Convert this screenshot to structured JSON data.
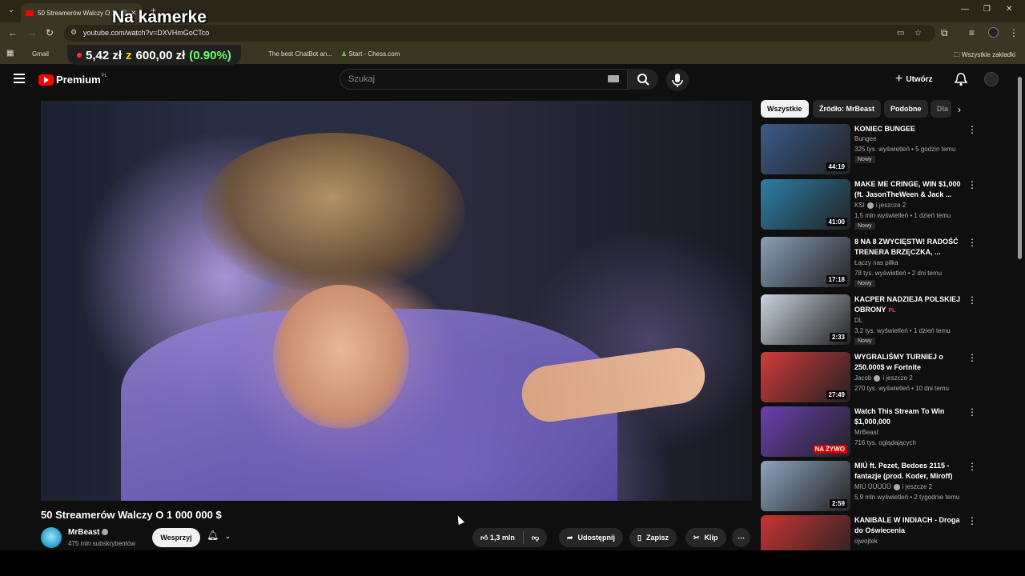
{
  "browser": {
    "tab_title": "50 Streamerów Walczy O 1...",
    "url": "youtube.com/watch?v=DXVHmGoCTco",
    "bookmarks": [
      "Gmail",
      "The best ChatBot an...",
      "Start - Chess.com"
    ],
    "all_bookmarks": "Wszystkie zakładki"
  },
  "overlay": {
    "title": "Na kamerke",
    "price_current": "5,42 zł",
    "price_of": "z",
    "price_goal": "600,00 zł",
    "price_pct": "(0.90%)"
  },
  "header": {
    "brand": "Premium",
    "brand_suffix": "PL",
    "search_placeholder": "Szukaj",
    "create_label": "Utwórz"
  },
  "video": {
    "title": "50 Streamerów Walczy O 1 000 000 $",
    "channel": "MrBeast",
    "subscribers": "475 mln subskrybentów",
    "support_label": "Wesprzyj",
    "likes": "1,3 mln",
    "share_label": "Udostępnij",
    "save_label": "Zapisz",
    "clip_label": "Klip"
  },
  "chips": [
    "Wszystkie",
    "Źródło: MrBeast",
    "Podobne",
    "Dla"
  ],
  "recommendations": [
    {
      "title": "KONIEC BUNGEE",
      "channel": "Bungee",
      "meta": "325 tys. wyświetleń • 5 godzin temu",
      "badge": "Nowy",
      "duration": "44:19",
      "thumb_color": "#3b5a8a"
    },
    {
      "title": "MAKE ME CRINGE, WIN $1,000 (ft. JasonTheWeen & Jack ...",
      "channel": "KSI",
      "channel_suffix": "i jeszcze 2",
      "meta": "1,5 mln wyświetleń • 1 dzień temu",
      "badge": "Nowy",
      "duration": "41:00",
      "thumb_color": "#2b7fa8"
    },
    {
      "title": "8 NA 8 ZWYCIĘSTW! RADOŚĆ TRENERA BRZĘCZKA, ...",
      "channel": "Łączy nas piłka",
      "meta": "78 tys. wyświetleń • 2 dni temu",
      "badge": "Nowy",
      "duration": "17:18",
      "thumb_color": "#8aa0b8"
    },
    {
      "title": "KACPER NADZIEJA POLSKIEJ OBRONY",
      "title_flag": "PL",
      "channel": "DL",
      "meta": "3,2 tys. wyświetleń • 1 dzień temu",
      "badge": "Nowy",
      "duration": "2:33",
      "thumb_color": "#c9d3de"
    },
    {
      "title": "WYGRALIŚMY TURNIEJ o 250.000$ w Fortnite",
      "channel": "Jacob",
      "channel_suffix": "i jeszcze 2",
      "meta": "270 tys. wyświetleń • 10 dni temu",
      "duration": "27:49",
      "thumb_color": "#d23a3a"
    },
    {
      "title": "Watch This Stream To Win $1,000,000",
      "channel": "MrBeast",
      "meta": "716 tys. oglądających",
      "duration": "NA ŻYWO",
      "thumb_color": "#6a3fb0"
    },
    {
      "title": "MIÚ ft. Pezet, Bedoes 2115 - fantazje (prod. Koder, Miroff)",
      "channel": "MIÚ ÜÜÜÜÜ",
      "channel_suffix": "i jeszcze 2",
      "meta": "5,9 mln wyświetleń • 2 tygodnie temu",
      "duration": "2:59",
      "thumb_color": "#8da3c0"
    },
    {
      "title": "KANIBALE W INDIACH - Droga do Oświecenia",
      "channel": "ojwojtek",
      "meta": "",
      "duration": "",
      "thumb_color": "#c93434"
    }
  ]
}
